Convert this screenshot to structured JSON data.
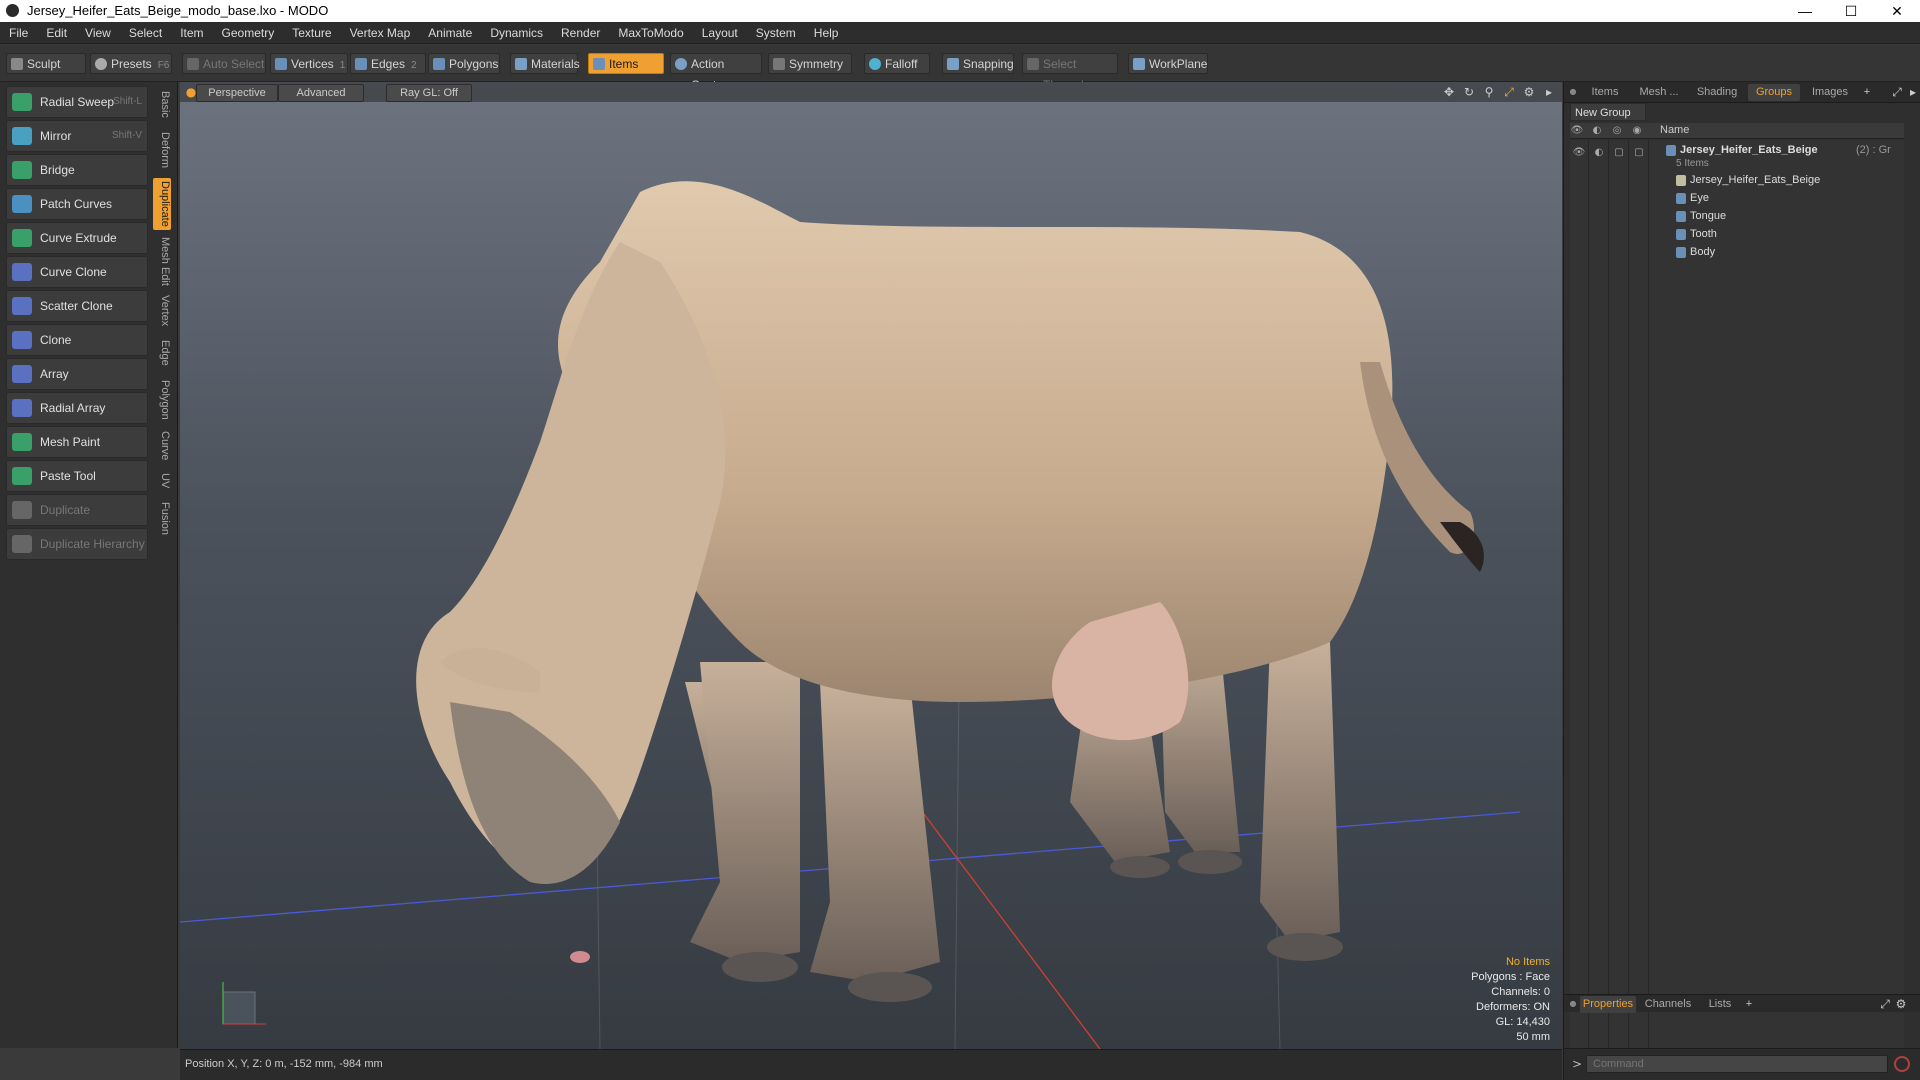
{
  "window": {
    "title": "Jersey_Heifer_Eats_Beige_modo_base.lxo - MODO",
    "min_glyph": "—",
    "max_glyph": "☐",
    "close_glyph": "✕"
  },
  "menu": [
    "File",
    "Edit",
    "View",
    "Select",
    "Item",
    "Geometry",
    "Texture",
    "Vertex Map",
    "Animate",
    "Dynamics",
    "Render",
    "MaxToModo",
    "Layout",
    "System",
    "Help"
  ],
  "toolbar": {
    "sculpt": "Sculpt",
    "presets": "Presets",
    "presets_key": "F6",
    "auto_select": "Auto Select",
    "vertices": "Vertices",
    "vertices_key": "1",
    "edges": "Edges",
    "edges_key": "2",
    "polygons": "Polygons",
    "materials": "Materials",
    "items": "Items",
    "action_center": "Action Center",
    "symmetry": "Symmetry",
    "falloff": "Falloff",
    "snapping": "Snapping",
    "select_through": "Select Through",
    "workplane": "WorkPlane"
  },
  "tools": [
    {
      "label": "Radial Sweep",
      "key": "Shift-L",
      "color": "#3aa06a"
    },
    {
      "label": "Mirror",
      "key": "Shift-V",
      "color": "#4aa0c0"
    },
    {
      "label": "Bridge",
      "key": "",
      "color": "#3aa06a"
    },
    {
      "label": "Patch Curves",
      "key": "",
      "color": "#4a90c0"
    },
    {
      "label": "Curve Extrude",
      "key": "",
      "color": "#3aa06a"
    },
    {
      "label": "Curve Clone",
      "key": "",
      "color": "#5a70c0"
    },
    {
      "label": "Scatter Clone",
      "key": "",
      "color": "#5a70c0"
    },
    {
      "label": "Clone",
      "key": "",
      "color": "#5a70c0"
    },
    {
      "label": "Array",
      "key": "",
      "color": "#5a70c0"
    },
    {
      "label": "Radial Array",
      "key": "",
      "color": "#5a70c0"
    },
    {
      "label": "Mesh Paint",
      "key": "",
      "color": "#3aa06a"
    },
    {
      "label": "Paste Tool",
      "key": "",
      "color": "#3aa06a"
    },
    {
      "label": "Duplicate",
      "key": "",
      "color": "#666666"
    },
    {
      "label": "Duplicate Hierarchy",
      "key": "",
      "color": "#666666"
    }
  ],
  "vtabs": [
    "Basic",
    "Deform",
    "Duplicate",
    "Mesh Edit",
    "Vertex",
    "Edge",
    "Polygon",
    "Curve",
    "UV",
    "Fusion"
  ],
  "viewport": {
    "perspective": "Perspective",
    "advanced": "Advanced",
    "raygl": "Ray GL: Off",
    "hud": {
      "no_items": "No Items",
      "polygons": "Polygons : Face",
      "channels": "Channels: 0",
      "deformers": "Deformers: ON",
      "gl": "GL: 14,430",
      "unit": "50 mm"
    }
  },
  "status": {
    "position": "Position X, Y, Z:   0 m, -152 mm, -984 mm",
    "prompt": ">",
    "command_placeholder": "Command"
  },
  "rightpanel": {
    "tabs": [
      "Items",
      "Mesh ...",
      "Shading",
      "Groups",
      "Images"
    ],
    "add": "+",
    "new_group": "New Group",
    "name_col": "Name",
    "group": {
      "name": "Jersey_Heifer_Eats_Beige",
      "suffix": "(2) : Gr",
      "count": "5 Items",
      "children": [
        "Jersey_Heifer_Eats_Beige",
        "Eye",
        "Tongue",
        "Tooth",
        "Body"
      ]
    },
    "bottom_tabs": [
      "Properties",
      "Channels",
      "Lists"
    ],
    "bottom_add": "+"
  }
}
